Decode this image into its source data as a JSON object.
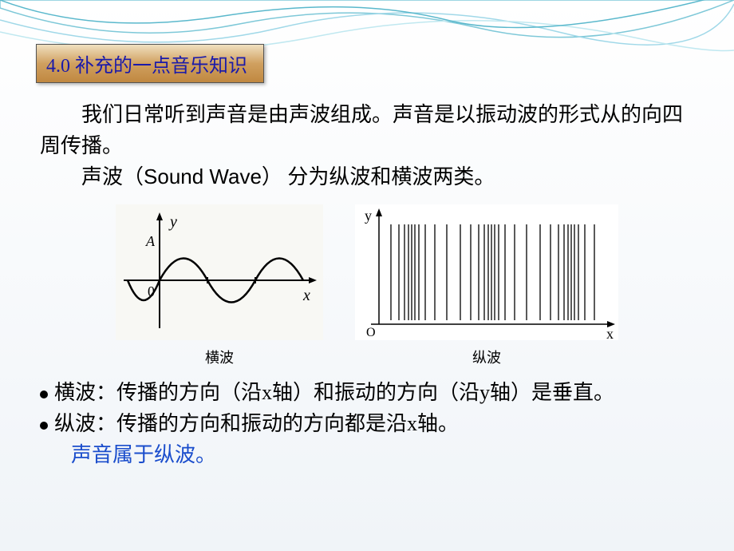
{
  "header": {
    "title": "4.0 补充的一点音乐知识"
  },
  "paragraphs": {
    "p1": "我们日常听到声音是由声波组成。声音是以振动波的形式从的向四周传播。",
    "p2_prefix": "声波（",
    "p2_english": "Sound Wave",
    "p2_suffix": "） 分为纵波和横波两类。"
  },
  "diagrams": {
    "left_label": "横波",
    "right_label": "纵波",
    "axis_y": "y",
    "axis_x": "x",
    "axis_O": "O",
    "axis_0": "0",
    "amplitude": "A"
  },
  "bullets": {
    "b1": "横波：传播的方向（沿x轴）和振动的方向（沿y轴）是垂直。",
    "b2": "纵波：传播的方向和振动的方向都是沿x轴。",
    "final_note": "声音属于纵波。"
  },
  "chart_data": [
    {
      "type": "line",
      "title": "横波",
      "xlabel": "x",
      "ylabel": "y",
      "series": [
        {
          "name": "transverse-wave",
          "x": [
            -1,
            -0.5,
            0,
            0.5,
            1,
            1.5,
            2,
            2.5,
            3
          ],
          "y": [
            0,
            -1,
            0,
            1,
            0,
            -1,
            0,
            1,
            0
          ]
        }
      ],
      "annotations": [
        "A",
        "0"
      ],
      "xlim": [
        -1,
        3
      ],
      "ylim": [
        -1.2,
        1.2
      ]
    },
    {
      "type": "line",
      "title": "纵波",
      "xlabel": "x",
      "ylabel": "y",
      "description": "vertical density lines showing compression and rarefaction along x-axis",
      "series": [
        {
          "name": "longitudinal-wave-positions",
          "x": [
            0.5,
            0.8,
            1.0,
            1.1,
            1.2,
            1.3,
            1.5,
            1.8,
            2.2,
            2.6,
            3.0,
            3.3,
            3.5,
            3.6,
            3.7,
            3.8,
            4.0,
            4.3,
            4.7,
            5.1,
            5.5,
            5.8,
            6.0,
            6.1,
            6.2,
            6.3,
            6.5,
            6.8,
            7.2,
            7.6
          ],
          "y_range": [
            0,
            1
          ]
        }
      ],
      "annotations": [
        "O"
      ],
      "xlim": [
        0,
        8
      ],
      "ylim": [
        0,
        1.2
      ]
    }
  ]
}
